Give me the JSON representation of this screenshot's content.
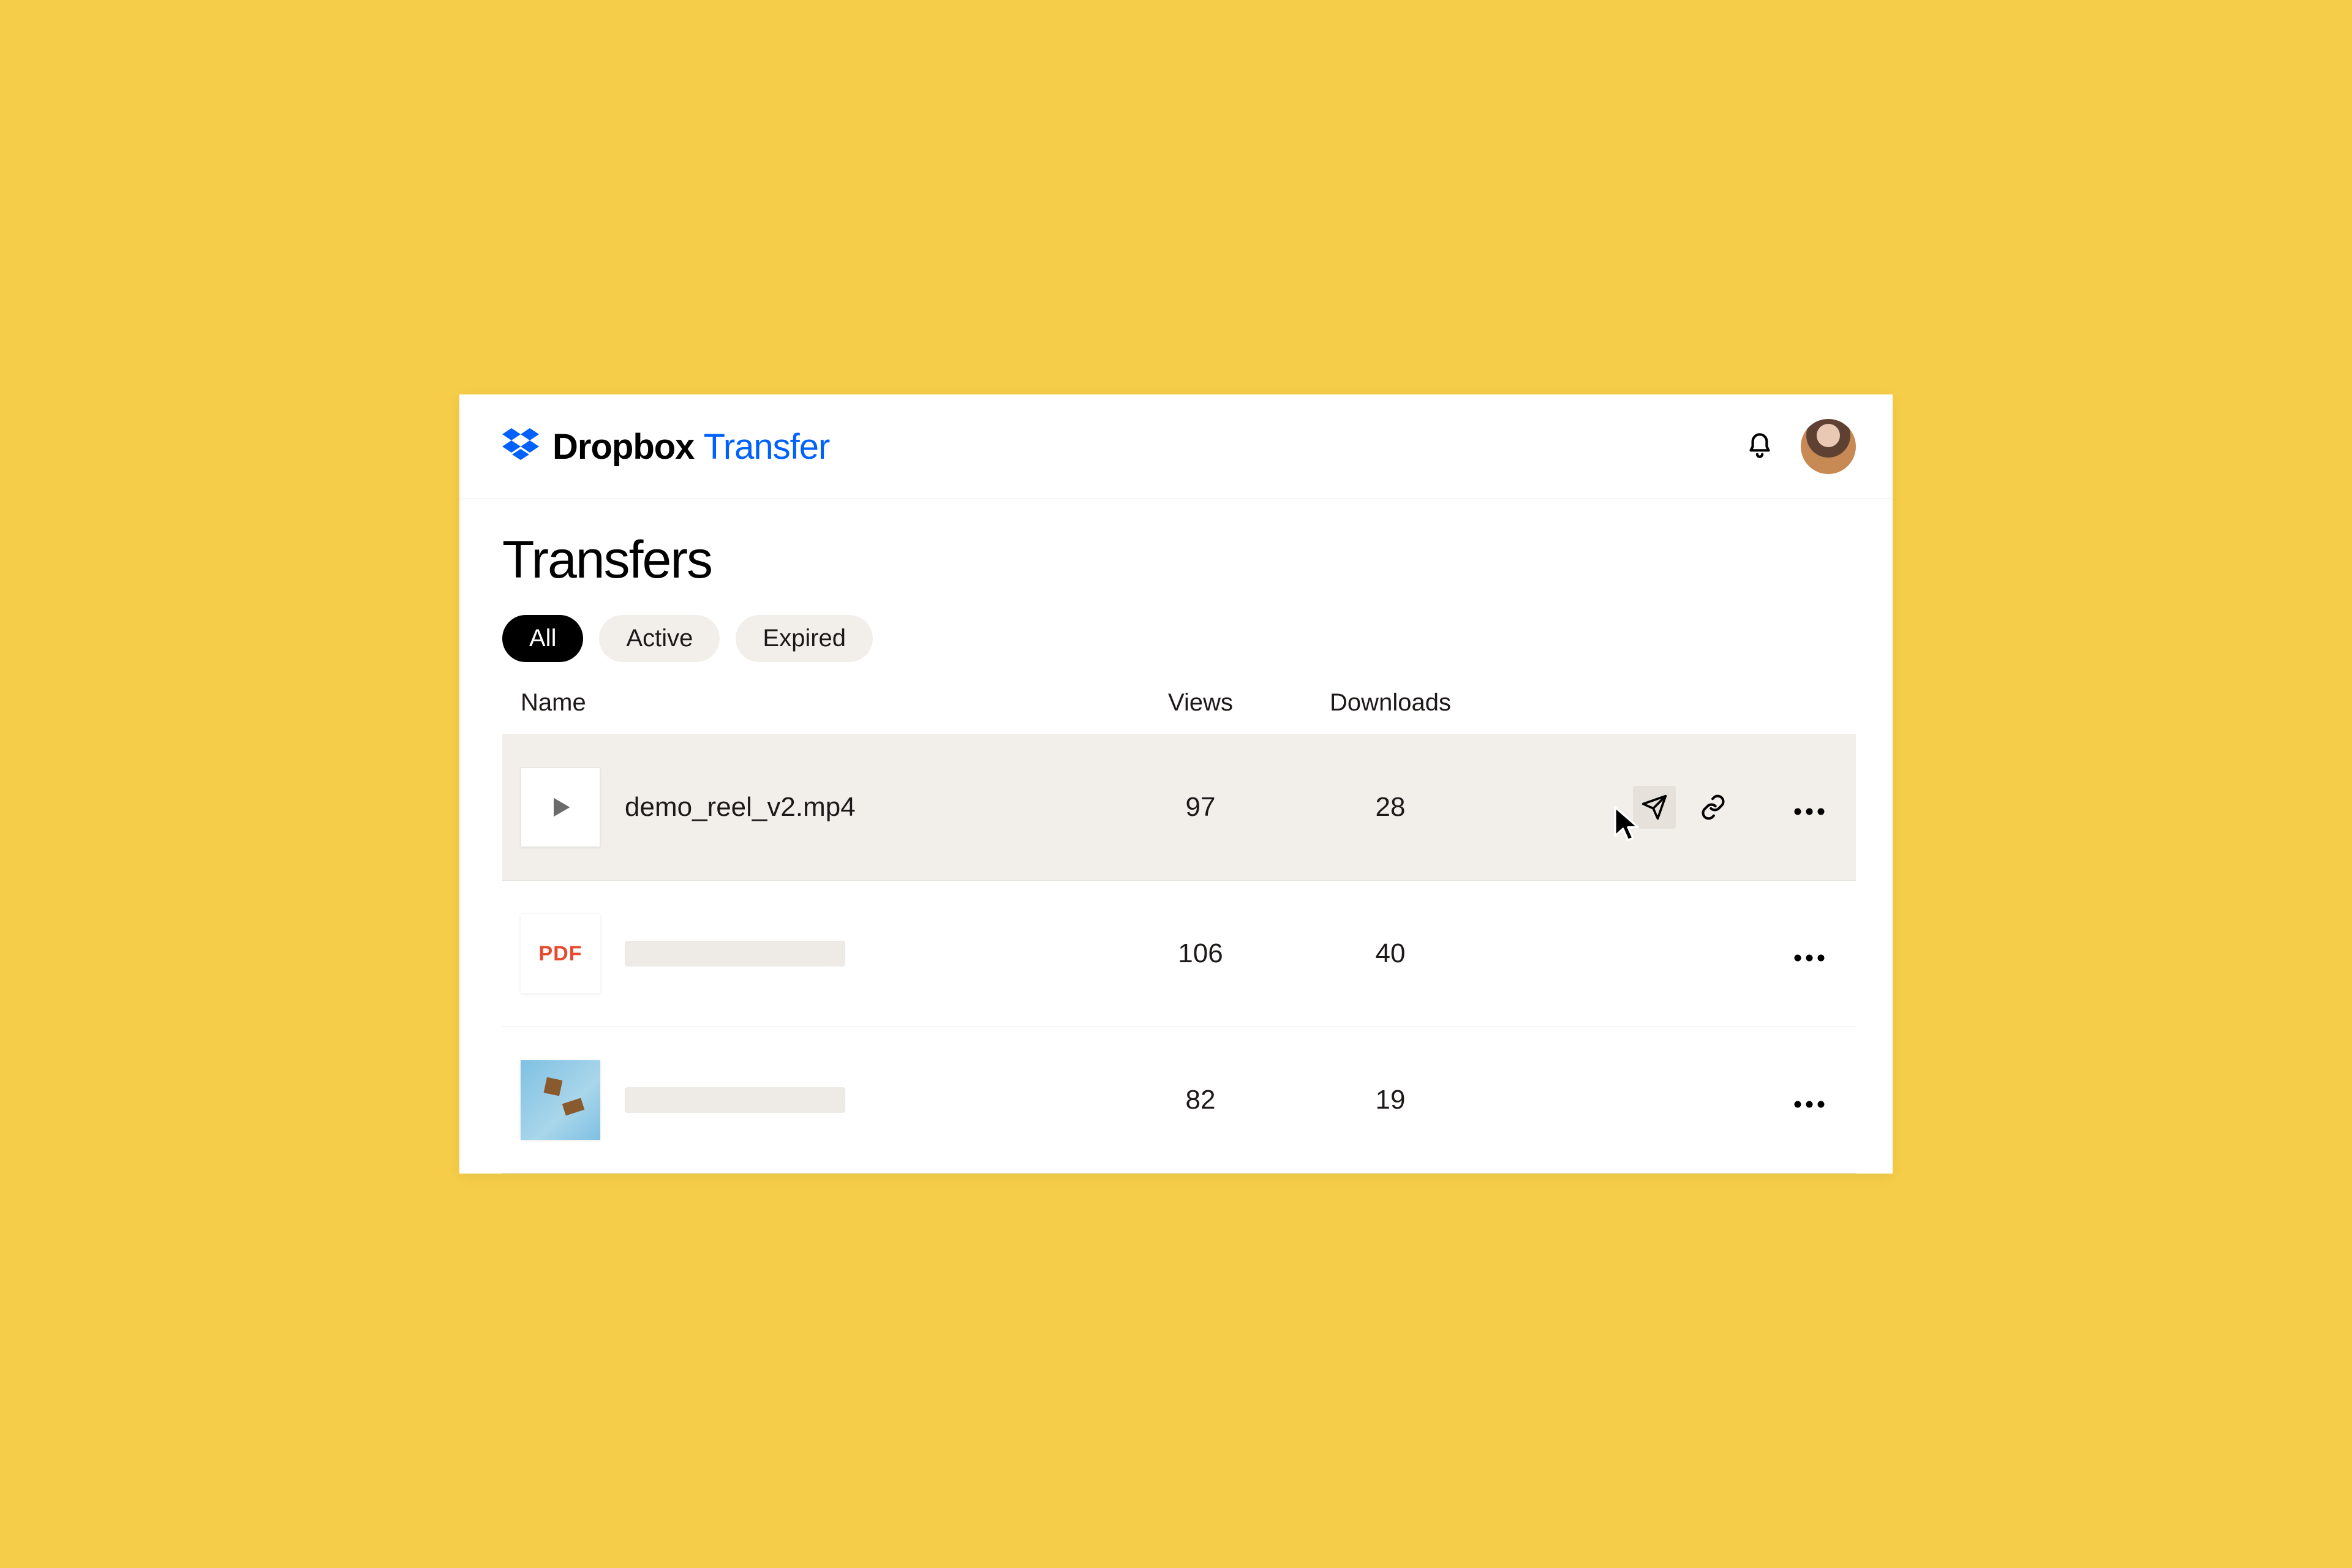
{
  "brand": {
    "name": "Dropbox",
    "accent": "Transfer"
  },
  "page": {
    "title": "Transfers"
  },
  "filters": [
    {
      "label": "All",
      "active": true
    },
    {
      "label": "Active",
      "active": false
    },
    {
      "label": "Expired",
      "active": false
    }
  ],
  "columns": {
    "name": "Name",
    "views": "Views",
    "downloads": "Downloads"
  },
  "rows": [
    {
      "type": "video",
      "name": "demo_reel_v2.mp4",
      "views": "97",
      "downloads": "28",
      "hovered": true
    },
    {
      "type": "pdf",
      "name": "",
      "views": "106",
      "downloads": "40",
      "hovered": false
    },
    {
      "type": "image",
      "name": "",
      "views": "82",
      "downloads": "19",
      "hovered": false
    }
  ],
  "icons": {
    "pdf_label": "PDF"
  }
}
